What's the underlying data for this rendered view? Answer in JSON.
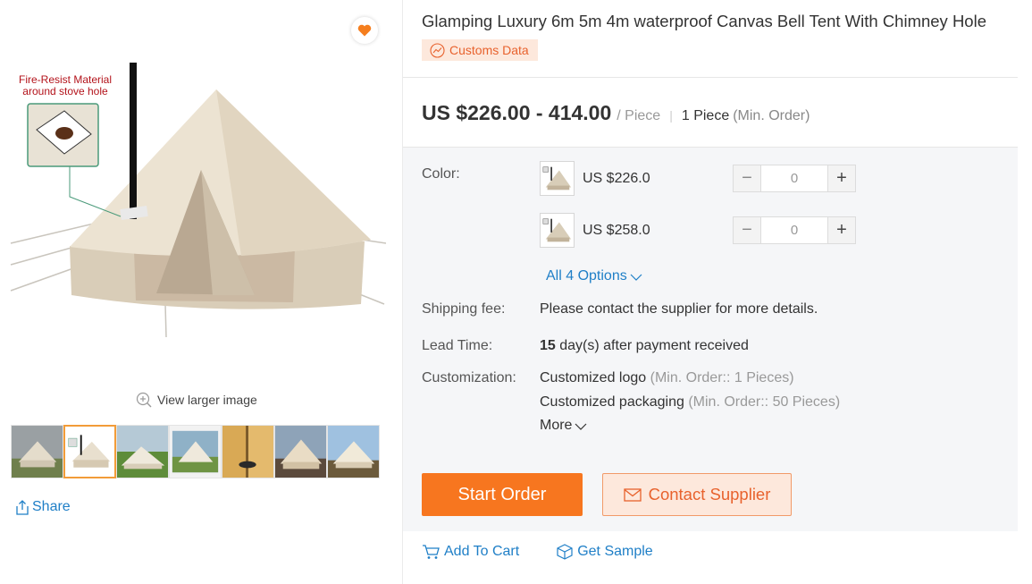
{
  "gallery": {
    "callout_title": "Fire-Resist Material around stove hole",
    "view_larger": "View larger image",
    "share": "Share",
    "thumbnails_count": 7,
    "active_thumbnail": 1
  },
  "product": {
    "title": "Glamping Luxury 6m 5m 4m waterproof Canvas Bell Tent With Chimney Hole",
    "customs_badge": "Customs Data",
    "price": "US $226.00 - 414.00",
    "price_unit": "/ Piece",
    "moq_value": "1 Piece",
    "moq_label": "(Min. Order)"
  },
  "specs": {
    "color_label": "Color:",
    "options": [
      {
        "price": "US $226.0",
        "qty": "0"
      },
      {
        "price": "US $258.0",
        "qty": "0"
      }
    ],
    "all_options": "All 4 Options",
    "shipping_label": "Shipping fee:",
    "shipping_value": "Please contact the supplier for more details.",
    "lead_label": "Lead Time:",
    "lead_days": "15",
    "lead_value": "day(s) after payment received",
    "custom_label": "Customization:",
    "custom_items": [
      {
        "name": "Customized logo",
        "note": "(Min. Order:: 1 Pieces)"
      },
      {
        "name": "Customized packaging",
        "note": "(Min. Order:: 50 Pieces)"
      }
    ],
    "more": "More"
  },
  "actions": {
    "start_order": "Start Order",
    "contact_supplier": "Contact Supplier",
    "add_to_cart": "Add To Cart",
    "get_sample": "Get Sample"
  },
  "colors": {
    "accent_orange": "#f7761f",
    "link_blue": "#1f7fc7",
    "fav_heart": "#f57e1e"
  }
}
